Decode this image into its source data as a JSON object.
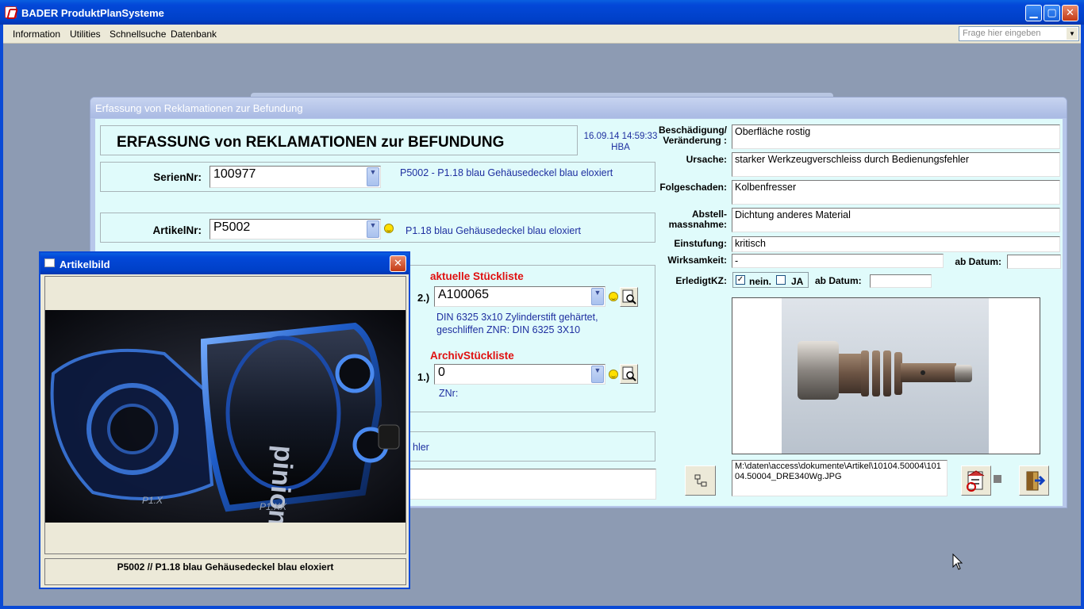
{
  "app": {
    "title": "BADER ProduktPlanSysteme"
  },
  "menu": {
    "items": [
      "Information",
      "Utilities",
      "Schnellsuche",
      "Datenbank"
    ],
    "ask_placeholder": "Frage hier eingeben"
  },
  "form": {
    "window_title": "Erfassung von Reklamationen zur Befundung",
    "heading": "ERFASSUNG von REKLAMATIONEN zur BEFUNDUNG",
    "timestamp": "16.09.14 14:59:33",
    "user": "HBA",
    "serien": {
      "label": "SerienNr:",
      "value": "100977",
      "desc": "P5002 - P1.18 blau Gehäusedeckel blau eloxiert"
    },
    "artikel": {
      "label": "ArtikelNr:",
      "value": "P5002",
      "desc": "P1.18 blau Gehäusedeckel blau eloxiert"
    },
    "stueckliste": {
      "current_label": "aktuelle Stückliste",
      "current_num": "2.)",
      "current_value": "A100065",
      "current_desc1": "DIN 6325 3x10 Zylinderstift gehärtet,",
      "current_desc2": "geschliffen   ZNR: DIN 6325 3X10",
      "archiv_label": "ArchivStückliste",
      "archiv_num": "1.)",
      "archiv_value": "0",
      "archiv_znr": "ZNr:"
    },
    "hidden_partial_text": "hler",
    "right": {
      "beschaedigung_label1": "Beschädigung/",
      "beschaedigung_label2": "Veränderung :",
      "beschaedigung_value": "Oberfläche rostig",
      "ursache_label": "Ursache:",
      "ursache_value": "starker Werkzeugverschleiss durch Bedienungsfehler",
      "folgeschaden_label": "Folgeschaden:",
      "folgeschaden_value": "Kolbenfresser",
      "abstell_label1": "Abstell-",
      "abstell_label2": "massnahme:",
      "abstell_value": "Dichtung anderes Material",
      "einstufung_label": "Einstufung:",
      "einstufung_value": "kritisch",
      "wirksamkeit_label": "Wirksamkeit:",
      "wirksamkeit_value": "-",
      "ab_datum_label": "ab Datum:",
      "ab_datum_value": "",
      "erledigt_label": "ErledigtKZ:",
      "nein_label": "nein.",
      "nein_checked": "✓",
      "ja_label": "JA",
      "ab_datum2_label": "ab Datum:",
      "ab_datum2_value": "",
      "image_path": "M:\\daten\\access\\dokumente\\Artikel\\10104.50004\\10104.50004_DRE340Wg.JPG"
    }
  },
  "popup": {
    "title": "Artikelbild",
    "caption": "P5002  //   P1.18 blau Gehäusedeckel blau eloxiert",
    "image_labels": [
      "pinion",
      "P1.X",
      "P1.XX"
    ]
  },
  "colors": {
    "xp_blue": "#0348d8",
    "form_bg": "#e0fbfb",
    "accent_red": "#e01010",
    "desc_blue": "#1e2fa0"
  }
}
